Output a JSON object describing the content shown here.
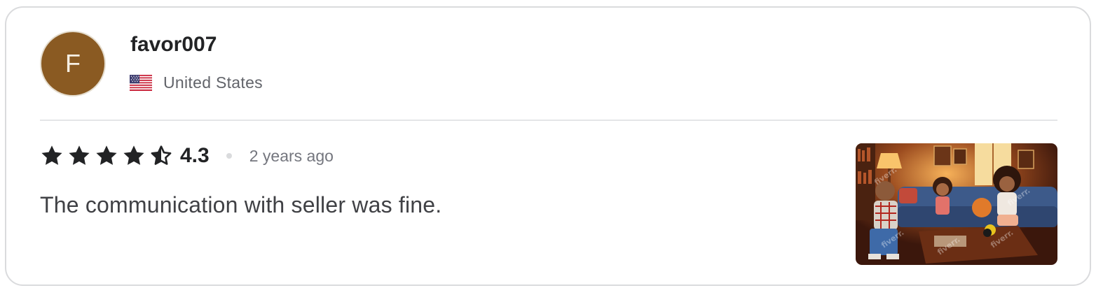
{
  "reviewer": {
    "avatar_initial": "F",
    "avatar_color": "#8a5a22",
    "username": "favor007",
    "country": "United States",
    "country_flag_icon": "us-flag-icon"
  },
  "review": {
    "rating": 4.3,
    "rating_label": "4.3",
    "stars": [
      "full",
      "full",
      "full",
      "full",
      "half"
    ],
    "time_ago": "2 years ago",
    "text": "The communication with seller was fine.",
    "attachment": {
      "type": "image",
      "description_icon": "review-image-thumbnail",
      "watermark": "fiverr."
    }
  },
  "colors": {
    "star": "#222325",
    "text_primary": "#222325",
    "text_secondary": "#62646a",
    "border": "#dadbdd"
  }
}
